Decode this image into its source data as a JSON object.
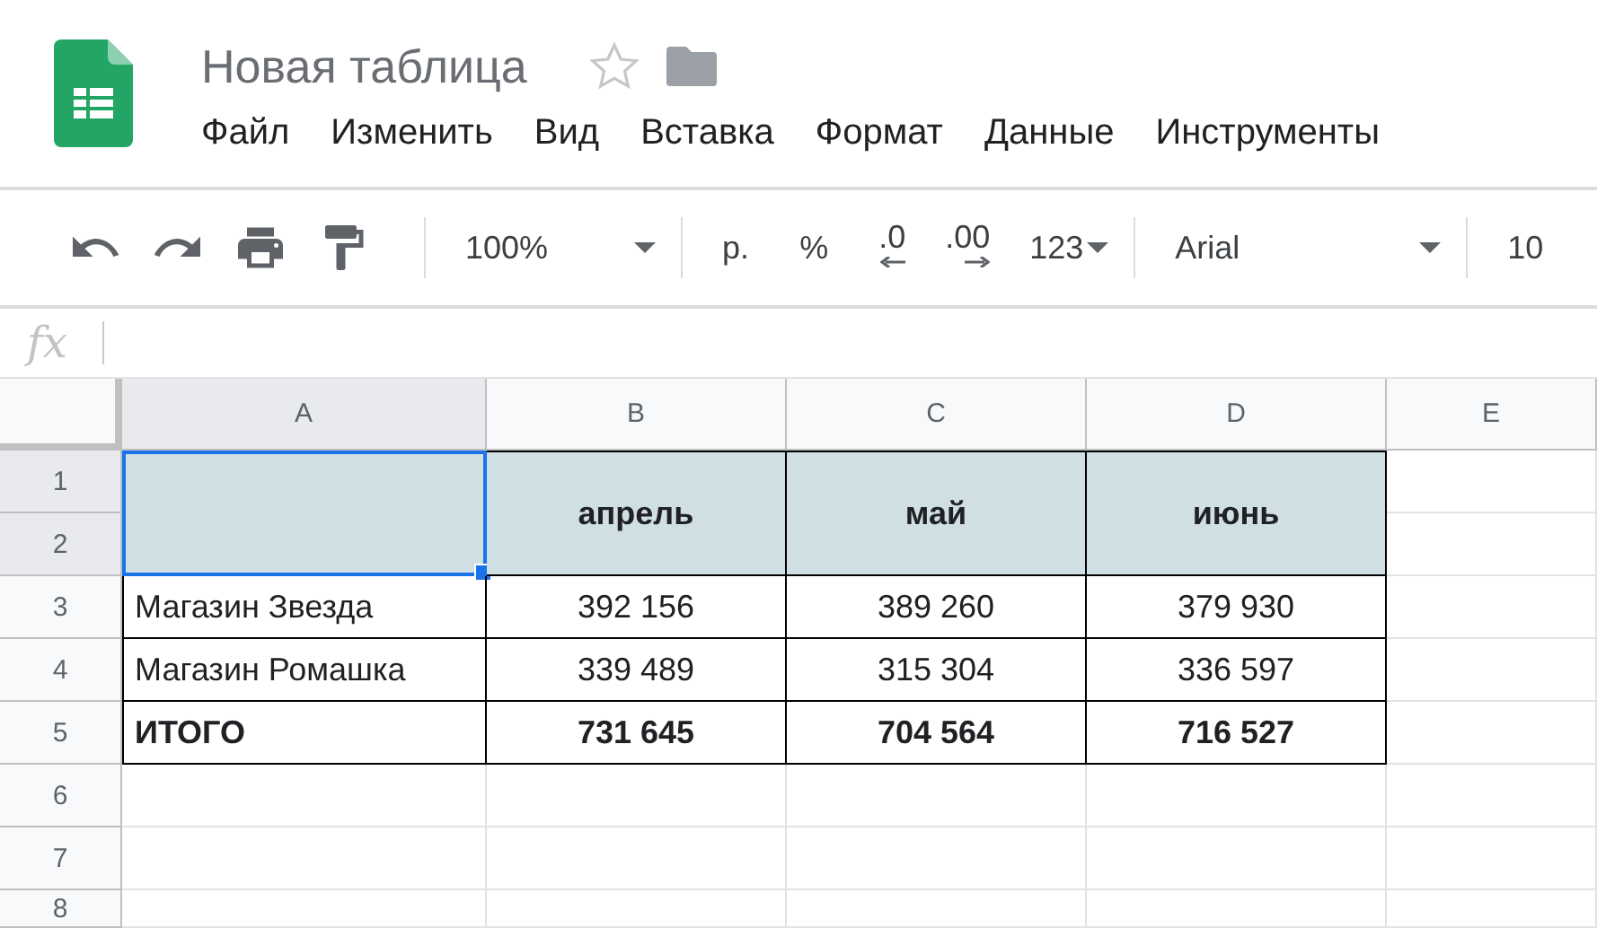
{
  "document": {
    "title": "Новая таблица",
    "starred": false
  },
  "menu": [
    "Файл",
    "Изменить",
    "Вид",
    "Вставка",
    "Формат",
    "Данные",
    "Инструменты"
  ],
  "toolbar": {
    "zoom": "100%",
    "currency": "р.",
    "percent": "%",
    "decimals_less": ".0",
    "decimals_more": ".00",
    "number_format": "123",
    "font": "Arial",
    "font_size": "10"
  },
  "formula_bar": {
    "label": "fx"
  },
  "columns": [
    {
      "label": "A",
      "selected": true
    },
    {
      "label": "B",
      "selected": false
    },
    {
      "label": "C",
      "selected": false
    },
    {
      "label": "D",
      "selected": false
    },
    {
      "label": "E",
      "selected": false
    }
  ],
  "rows": [
    {
      "label": "1",
      "selected": true
    },
    {
      "label": "2",
      "selected": true
    },
    {
      "label": "3",
      "selected": false
    },
    {
      "label": "4",
      "selected": false
    },
    {
      "label": "5",
      "selected": false
    },
    {
      "label": "6",
      "selected": false
    },
    {
      "label": "7",
      "selected": false
    },
    {
      "label": "8",
      "selected": false
    }
  ],
  "table": {
    "header": [
      {
        "selected": true
      },
      {
        "text": "апрель",
        "selected": false
      },
      {
        "text": "май",
        "selected": false
      },
      {
        "text": "июнь",
        "selected": false
      }
    ],
    "rows": [
      {
        "kind": "data",
        "cells": [
          "Магазин Звезда",
          "392 156",
          "389 260",
          "379 930"
        ]
      },
      {
        "kind": "data",
        "cells": [
          "Магазин Ромашка",
          "339 489",
          "315 304",
          "336 597"
        ]
      },
      {
        "kind": "total",
        "cells": [
          "ИТОГО",
          "731 645",
          "704 564",
          "716 527"
        ]
      }
    ]
  }
}
